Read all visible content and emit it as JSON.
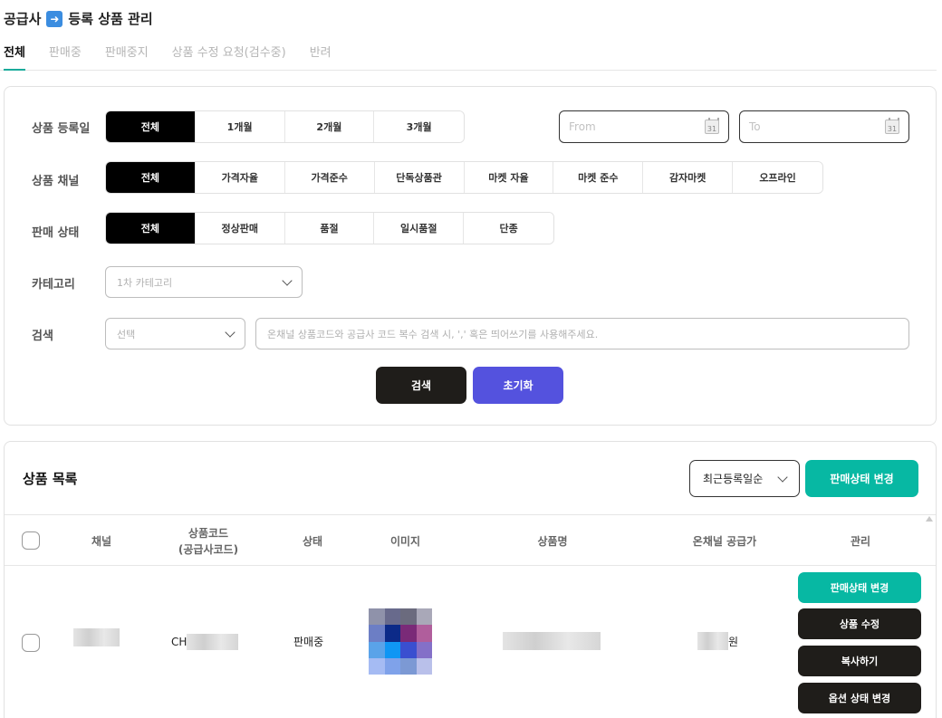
{
  "header": {
    "title_left": "공급사",
    "title_right": "등록 상품 관리"
  },
  "tabs": [
    {
      "label": "전체",
      "active": true
    },
    {
      "label": "판매중",
      "active": false
    },
    {
      "label": "판매중지",
      "active": false
    },
    {
      "label": "상품 수정 요청(검수중)",
      "active": false
    },
    {
      "label": "반려",
      "active": false
    }
  ],
  "filters": {
    "reg_date": {
      "label": "상품 등록일",
      "options": [
        "전체",
        "1개월",
        "2개월",
        "3개월"
      ]
    },
    "date_from_placeholder": "From",
    "date_to_placeholder": "To",
    "calendar_day": "31",
    "channel": {
      "label": "상품 채널",
      "options": [
        "전체",
        "가격자율",
        "가격준수",
        "단독상품관",
        "마켓 자율",
        "마켓 준수",
        "감자마켓",
        "오프라인"
      ]
    },
    "sale_status": {
      "label": "판매 상태",
      "options": [
        "전체",
        "정상판매",
        "품절",
        "일시품절",
        "단종"
      ]
    },
    "category": {
      "label": "카테고리",
      "placeholder": "1차 카테고리"
    },
    "search": {
      "label": "검색",
      "select_placeholder": "선택",
      "input_placeholder": "온채널 상품코드와 공급사 코드 복수 검색 시, ',' 혹은 띄어쓰기를 사용해주세요."
    },
    "search_button": "검색",
    "reset_button": "초기화"
  },
  "list": {
    "title": "상품 목록",
    "sort_value": "최근등록일순",
    "bulk_status_button": "판매상태 변경",
    "columns": {
      "channel": "채널",
      "code_line1": "상품코드",
      "code_line2": "(공급사코드)",
      "status": "상태",
      "image": "이미지",
      "name": "상품명",
      "price": "온채널 공급가",
      "manage": "관리"
    },
    "rows": [
      {
        "code_prefix": "CH",
        "status": "판매중",
        "price_unit": "원",
        "actions": [
          "판매상태 변경",
          "상품 수정",
          "복사하기",
          "옵션 상태 변경"
        ]
      }
    ]
  },
  "colors": {
    "accent_teal": "#07b8a3",
    "tab_underline": "#1aab9b",
    "reset_blue": "#5452de",
    "dark_button": "#1f1d1a",
    "thumb_pixels": [
      "#8f92aa",
      "#686a8c",
      "#6b6b7e",
      "#a9a8b8",
      "#6c7ec5",
      "#0c2a88",
      "#7a2a78",
      "#b05e9c",
      "#5aa3e9",
      "#0f96f4",
      "#3a4fd0",
      "#8470c8",
      "#a5bbf3",
      "#7fa2ea",
      "#7c99d4",
      "#b9c0ea"
    ]
  }
}
